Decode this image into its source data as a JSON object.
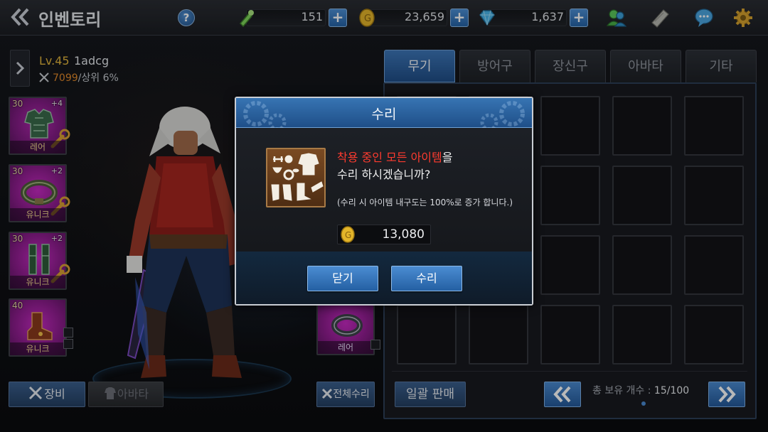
{
  "header": {
    "title": "인벤토리",
    "help_label": "?",
    "stamina": "151",
    "gold": "23,659",
    "gems": "1,637",
    "plus_label": "+"
  },
  "character": {
    "level": "Lv.45",
    "name": "1adcg",
    "power": "7099",
    "rank": "/상위 6%",
    "equip_slots": [
      {
        "level": "30",
        "plus": "+4",
        "grade": "레어"
      },
      {
        "level": "30",
        "plus": "+2",
        "grade": "유니크"
      },
      {
        "level": "30",
        "plus": "+2",
        "grade": "유니크"
      },
      {
        "level": "40",
        "plus": "",
        "grade": "유니크"
      },
      {
        "grade": "레어"
      }
    ],
    "equip_tab": "장비",
    "avatar_tab": "아바타",
    "repair_all": "전체수리"
  },
  "inventory": {
    "tabs": [
      "무기",
      "방어구",
      "장신구",
      "아바타",
      "기타"
    ],
    "active_tab": 0,
    "bulk_sell": "일괄 판매",
    "total_label": "총 보유 개수 : ",
    "total_value": "15/100",
    "prev_icon": "double-chevron-left-icon",
    "next_icon": "double-chevron-right-icon"
  },
  "modal": {
    "title": "수리",
    "line1_highlight": "착용 중인 모든 아이템",
    "line1_rest": "을",
    "line2": "수리 하시겠습니까?",
    "note": "(수리 시 아이템 내구도는 100%로 증가 합니다.)",
    "cost": "13,080",
    "close_label": "닫기",
    "repair_label": "수리"
  },
  "colors": {
    "accent_blue": "#2563a6",
    "highlight_red": "#ff3b2f",
    "level_gold": "#e4b63c",
    "unique_purple": "#c62ac2"
  }
}
